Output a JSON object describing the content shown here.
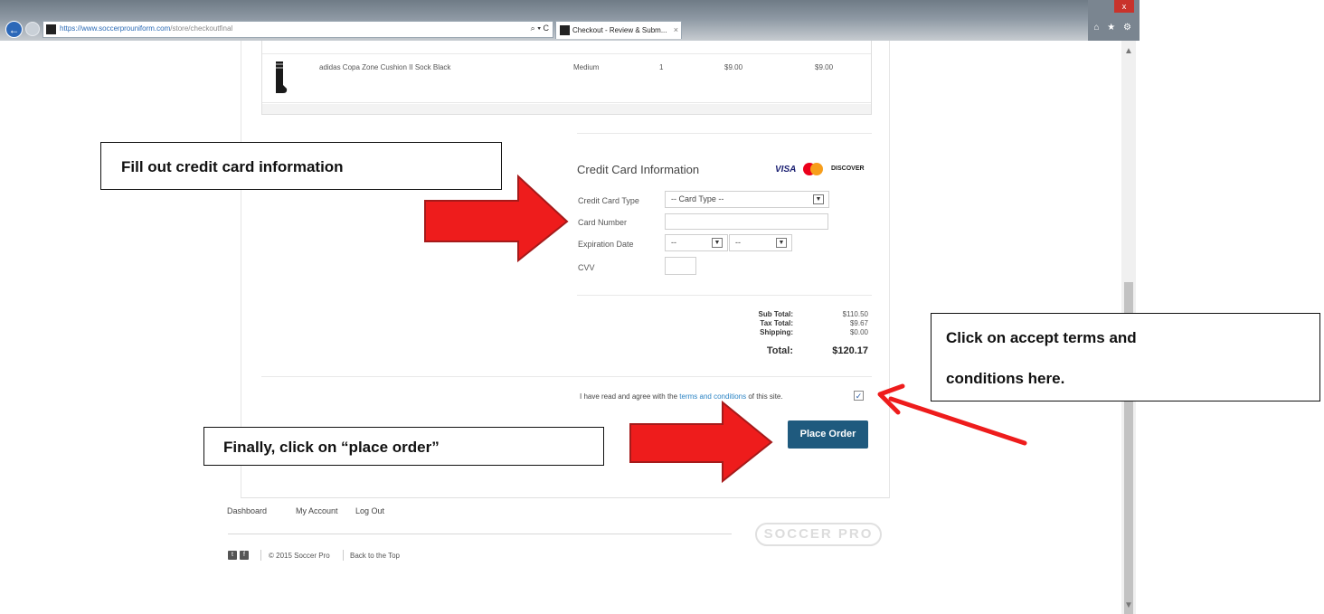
{
  "browser": {
    "url_domain": "https://www.soccerprouniform.com",
    "url_path": "/store/checkoutfinal",
    "tab_title": "Checkout - Review & Subm...",
    "search_glyph": "⌕ ▾ C",
    "tab_close": "×",
    "window_close": "x",
    "toolbar_icons": "⌂ ★ ⚙"
  },
  "cart": {
    "item": {
      "name": "adidas Copa Zone Cushion II Sock Black",
      "size": "Medium",
      "quantity": "1",
      "price": "$9.00",
      "line_total": "$9.00"
    }
  },
  "credit_card": {
    "title": "Credit Card Information",
    "brands": {
      "visa": "VISA",
      "discover": "DISCOVER"
    },
    "fields": {
      "type_label": "Credit Card Type",
      "type_value": "-- Card Type --",
      "number_label": "Card Number",
      "number_value": "",
      "expiration_label": "Expiration Date",
      "exp_month_value": "--",
      "exp_year_value": "--",
      "cvv_label": "CVV",
      "cvv_value": ""
    }
  },
  "totals": {
    "sub_total_label": "Sub Total:",
    "sub_total": "$110.50",
    "tax_total_label": "Tax Total:",
    "tax_total": "$9.67",
    "shipping_label": "Shipping:",
    "shipping": "$0.00",
    "total_label": "Total:",
    "total": "$120.17"
  },
  "terms": {
    "prefix": "I have read and agree with the ",
    "link": "terms and conditions",
    "suffix": " of this site.",
    "checked": true,
    "check_glyph": "✓"
  },
  "place_order_label": "Place Order",
  "footer": {
    "links": [
      "Dashboard",
      "My Account",
      "Log Out"
    ],
    "copyright": "© 2015 Soccer Pro",
    "back_to_top": "Back to the Top",
    "logo_text": "SOCCER PRO",
    "social": [
      "t",
      "f"
    ]
  },
  "annotations": {
    "fill_out": "Fill out credit card information",
    "accept_terms_line1": "Click on accept terms and",
    "accept_terms_line2": "conditions here.",
    "place_order": "Finally, click on “place order”",
    "arrow_color": "#ee1c1c"
  },
  "colors": {
    "primary_button": "#1f5a7e",
    "link": "#2a83c4"
  }
}
